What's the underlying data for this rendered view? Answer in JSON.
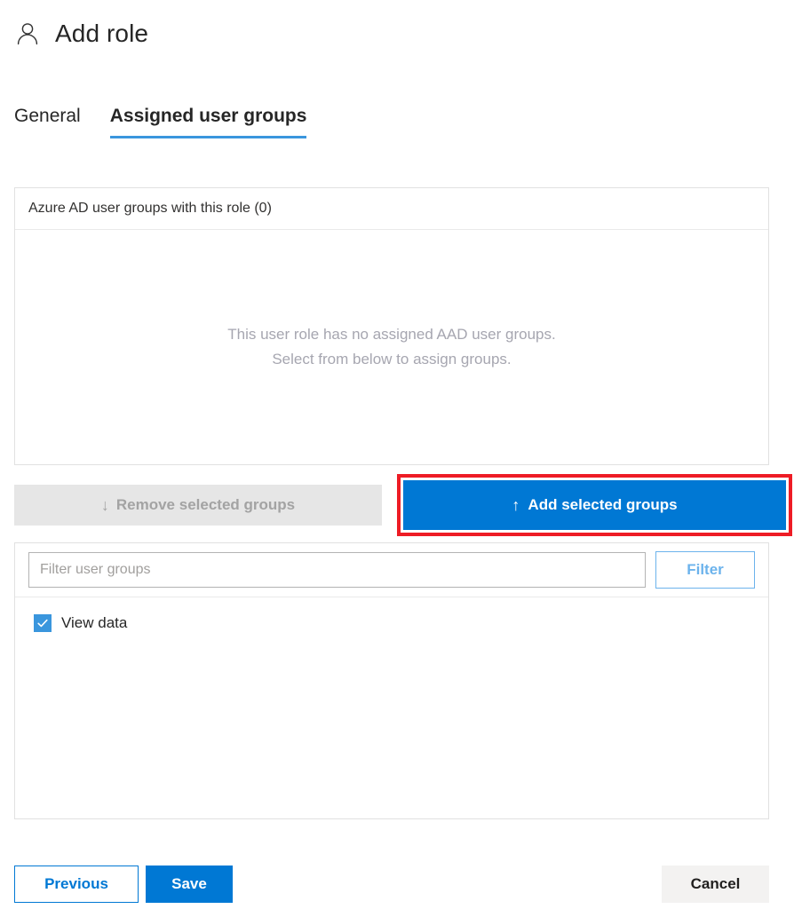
{
  "header": {
    "icon": "person-icon",
    "title": "Add role"
  },
  "tabs": [
    {
      "label": "General",
      "active": false
    },
    {
      "label": "Assigned user groups",
      "active": true
    }
  ],
  "assigned_panel": {
    "header": "Azure AD user groups with this role (0)",
    "empty_line1": "This user role has no assigned AAD user groups.",
    "empty_line2": "Select from below to assign groups."
  },
  "actions": {
    "remove_label": "Remove selected groups",
    "remove_icon": "arrow-down-icon",
    "remove_arrow": "↓",
    "add_label": "Add selected groups",
    "add_icon": "arrow-up-icon",
    "add_arrow": "↑",
    "highlight_color": "#ee1c25"
  },
  "filter_panel": {
    "input_value": "",
    "input_placeholder": "Filter user groups",
    "filter_button_label": "Filter",
    "groups": [
      {
        "label": "View data",
        "checked": true
      }
    ]
  },
  "footer": {
    "previous_label": "Previous",
    "save_label": "Save",
    "cancel_label": "Cancel"
  },
  "colors": {
    "accent": "#0078d4",
    "tab_underline": "#3a96dd",
    "highlight": "#ee1c25",
    "disabled_bg": "#e6e6e6",
    "disabled_text": "#a3a3a3"
  }
}
